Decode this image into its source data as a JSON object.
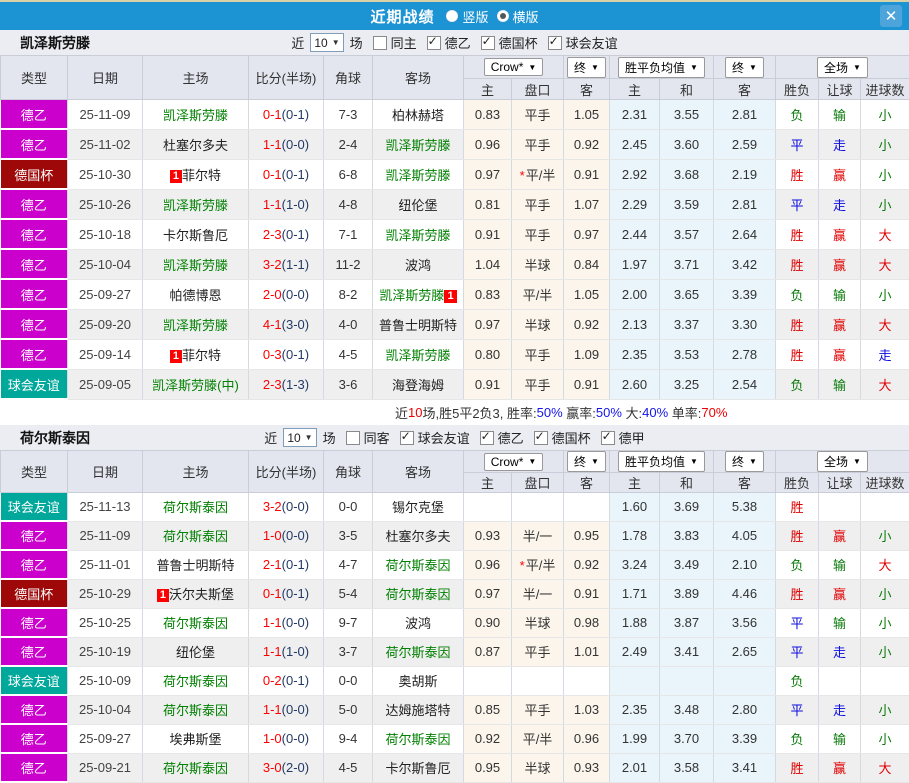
{
  "titlebar": {
    "title": "近期战绩",
    "radios": [
      {
        "label": "竖版",
        "checked": false
      },
      {
        "label": "横版",
        "checked": true
      }
    ],
    "close_icon": "✕",
    "bar_color": "#1C93D2"
  },
  "table": {
    "main_headers": [
      "类型",
      "日期",
      "主场",
      "比分(半场)",
      "角球",
      "客场"
    ],
    "group_headers": [
      {
        "label": "Crow*",
        "span": 2,
        "name": "odds-company-select"
      },
      {
        "label": "终",
        "span": 1,
        "name": "odds-final-select"
      },
      {
        "label": "胜平负均值",
        "span": 2,
        "name": "avg-odds-select"
      },
      {
        "label": "终",
        "span": 1,
        "name": "avg-final-select"
      },
      {
        "label": "全场",
        "span": 3,
        "name": "scope-select"
      }
    ],
    "sub_headers": [
      "主",
      "盘口",
      "客",
      "主",
      "和",
      "客",
      "胜负",
      "让球",
      "进球数"
    ]
  },
  "type_colors": {
    "德乙": "#CC00CC",
    "德国杯": "#9E0808",
    "球会友谊": "#00A79B",
    "德甲": "#CC00CC"
  },
  "result_colors": {
    "胜": "#E00000",
    "赢": "#E00000",
    "大": "#E00000",
    "平": "#0B0BE0",
    "走": "#0B0BE0",
    "负": "#0A7A0A",
    "输": "#0A7A0A",
    "小": "#0A7A0A"
  },
  "sections": [
    {
      "team": "凯泽斯劳滕",
      "filter": {
        "near_label": "近",
        "count": "10",
        "games_label": "场",
        "same": {
          "label": "同主",
          "checked": false
        },
        "leagues": [
          {
            "label": "德乙",
            "checked": true
          },
          {
            "label": "德国杯",
            "checked": true
          },
          {
            "label": "球会友谊",
            "checked": true
          }
        ]
      },
      "rows": [
        {
          "type": "德乙",
          "date": "25-11-09",
          "home": {
            "n": "凯泽斯劳滕",
            "g": true
          },
          "score": "0-1",
          "half": "(0-1)",
          "corner": "7-3",
          "away": {
            "n": "柏林赫塔"
          },
          "odds": [
            "0.83",
            "平手",
            "1.05"
          ],
          "star": false,
          "avg": [
            "2.31",
            "3.55",
            "2.81"
          ],
          "res": [
            "负",
            "输",
            "小"
          ]
        },
        {
          "type": "德乙",
          "date": "25-11-02",
          "home": {
            "n": "杜塞尔多夫"
          },
          "score": "1-1",
          "half": "(0-0)",
          "corner": "2-4",
          "away": {
            "n": "凯泽斯劳滕",
            "g": true
          },
          "odds": [
            "0.96",
            "平手",
            "0.92"
          ],
          "star": false,
          "avg": [
            "2.45",
            "3.60",
            "2.59"
          ],
          "res": [
            "平",
            "走",
            "小"
          ]
        },
        {
          "type": "德国杯",
          "date": "25-10-30",
          "home": {
            "n": "菲尔特",
            "badge": "1",
            "badge_pos": "before"
          },
          "score": "0-1",
          "half": "(0-1)",
          "corner": "6-8",
          "away": {
            "n": "凯泽斯劳滕",
            "g": true
          },
          "odds": [
            "0.97",
            "平/半",
            "0.91"
          ],
          "star": true,
          "avg": [
            "2.92",
            "3.68",
            "2.19"
          ],
          "res": [
            "胜",
            "赢",
            "小"
          ]
        },
        {
          "type": "德乙",
          "date": "25-10-26",
          "home": {
            "n": "凯泽斯劳滕",
            "g": true
          },
          "score": "1-1",
          "half": "(1-0)",
          "corner": "4-8",
          "away": {
            "n": "纽伦堡"
          },
          "odds": [
            "0.81",
            "平手",
            "1.07"
          ],
          "star": false,
          "avg": [
            "2.29",
            "3.59",
            "2.81"
          ],
          "res": [
            "平",
            "走",
            "小"
          ]
        },
        {
          "type": "德乙",
          "date": "25-10-18",
          "home": {
            "n": "卡尔斯鲁厄"
          },
          "score": "2-3",
          "half": "(0-1)",
          "corner": "7-1",
          "away": {
            "n": "凯泽斯劳滕",
            "g": true
          },
          "odds": [
            "0.91",
            "平手",
            "0.97"
          ],
          "star": false,
          "avg": [
            "2.44",
            "3.57",
            "2.64"
          ],
          "res": [
            "胜",
            "赢",
            "大"
          ]
        },
        {
          "type": "德乙",
          "date": "25-10-04",
          "home": {
            "n": "凯泽斯劳滕",
            "g": true
          },
          "score": "3-2",
          "half": "(1-1)",
          "corner": "11-2",
          "away": {
            "n": "波鸿"
          },
          "odds": [
            "1.04",
            "半球",
            "0.84"
          ],
          "star": false,
          "avg": [
            "1.97",
            "3.71",
            "3.42"
          ],
          "res": [
            "胜",
            "赢",
            "大"
          ]
        },
        {
          "type": "德乙",
          "date": "25-09-27",
          "home": {
            "n": "帕德博恩"
          },
          "score": "2-0",
          "half": "(0-0)",
          "corner": "8-2",
          "away": {
            "n": "凯泽斯劳滕",
            "g": true,
            "badge": "1",
            "badge_pos": "after"
          },
          "odds": [
            "0.83",
            "平/半",
            "1.05"
          ],
          "star": false,
          "avg": [
            "2.00",
            "3.65",
            "3.39"
          ],
          "res": [
            "负",
            "输",
            "小"
          ]
        },
        {
          "type": "德乙",
          "date": "25-09-20",
          "home": {
            "n": "凯泽斯劳滕",
            "g": true
          },
          "score": "4-1",
          "half": "(3-0)",
          "corner": "4-0",
          "away": {
            "n": "普鲁士明斯特"
          },
          "odds": [
            "0.97",
            "半球",
            "0.92"
          ],
          "star": false,
          "avg": [
            "2.13",
            "3.37",
            "3.30"
          ],
          "res": [
            "胜",
            "赢",
            "大"
          ]
        },
        {
          "type": "德乙",
          "date": "25-09-14",
          "home": {
            "n": "菲尔特",
            "badge": "1",
            "badge_pos": "before"
          },
          "score": "0-3",
          "half": "(0-1)",
          "corner": "4-5",
          "away": {
            "n": "凯泽斯劳滕",
            "g": true
          },
          "odds": [
            "0.80",
            "平手",
            "1.09"
          ],
          "star": false,
          "avg": [
            "2.35",
            "3.53",
            "2.78"
          ],
          "res": [
            "胜",
            "赢",
            "走"
          ]
        },
        {
          "type": "球会友谊",
          "date": "25-09-05",
          "home": {
            "n": "凯泽斯劳滕(中)",
            "g": true
          },
          "score": "2-3",
          "half": "(1-3)",
          "corner": "3-6",
          "away": {
            "n": "海登海姆"
          },
          "odds": [
            "0.91",
            "平手",
            "0.91"
          ],
          "star": false,
          "avg": [
            "2.60",
            "3.25",
            "2.54"
          ],
          "res": [
            "负",
            "输",
            "大"
          ]
        }
      ],
      "summary": [
        {
          "t": "近",
          "c": "#333"
        },
        {
          "t": "10",
          "c": "#EE0000"
        },
        {
          "t": "场,胜5平2负3, 胜率:",
          "c": "#333"
        },
        {
          "t": "50%",
          "c": "#1414E6"
        },
        {
          "t": " 赢率:",
          "c": "#333"
        },
        {
          "t": "50%",
          "c": "#1414E6"
        },
        {
          "t": " 大:",
          "c": "#333"
        },
        {
          "t": "40%",
          "c": "#1414E6"
        },
        {
          "t": " 单率:",
          "c": "#333"
        },
        {
          "t": "70%",
          "c": "#EE0000"
        }
      ]
    },
    {
      "team": "荷尔斯泰因",
      "filter": {
        "near_label": "近",
        "count": "10",
        "games_label": "场",
        "same": {
          "label": "同客",
          "checked": false
        },
        "leagues": [
          {
            "label": "球会友谊",
            "checked": true
          },
          {
            "label": "德乙",
            "checked": true
          },
          {
            "label": "德国杯",
            "checked": true
          },
          {
            "label": "德甲",
            "checked": true
          }
        ]
      },
      "rows": [
        {
          "type": "球会友谊",
          "date": "25-11-13",
          "home": {
            "n": "荷尔斯泰因",
            "g": true
          },
          "score": "3-2",
          "half": "(0-0)",
          "corner": "0-0",
          "away": {
            "n": "锡尔克堡"
          },
          "odds": [
            "",
            "",
            ""
          ],
          "star": false,
          "avg": [
            "1.60",
            "3.69",
            "5.38"
          ],
          "res": [
            "胜",
            "",
            ""
          ]
        },
        {
          "type": "德乙",
          "date": "25-11-09",
          "home": {
            "n": "荷尔斯泰因",
            "g": true
          },
          "score": "1-0",
          "half": "(0-0)",
          "corner": "3-5",
          "away": {
            "n": "杜塞尔多夫"
          },
          "odds": [
            "0.93",
            "半/一",
            "0.95"
          ],
          "star": false,
          "avg": [
            "1.78",
            "3.83",
            "4.05"
          ],
          "res": [
            "胜",
            "赢",
            "小"
          ]
        },
        {
          "type": "德乙",
          "date": "25-11-01",
          "home": {
            "n": "普鲁士明斯特"
          },
          "score": "2-1",
          "half": "(0-1)",
          "corner": "4-7",
          "away": {
            "n": "荷尔斯泰因",
            "g": true
          },
          "odds": [
            "0.96",
            "平/半",
            "0.92"
          ],
          "star": true,
          "avg": [
            "3.24",
            "3.49",
            "2.10"
          ],
          "res": [
            "负",
            "输",
            "大"
          ]
        },
        {
          "type": "德国杯",
          "date": "25-10-29",
          "home": {
            "n": "沃尔夫斯堡",
            "badge": "1",
            "badge_pos": "before"
          },
          "score": "0-1",
          "half": "(0-1)",
          "corner": "5-4",
          "away": {
            "n": "荷尔斯泰因",
            "g": true
          },
          "odds": [
            "0.97",
            "半/一",
            "0.91"
          ],
          "star": false,
          "avg": [
            "1.71",
            "3.89",
            "4.46"
          ],
          "res": [
            "胜",
            "赢",
            "小"
          ]
        },
        {
          "type": "德乙",
          "date": "25-10-25",
          "home": {
            "n": "荷尔斯泰因",
            "g": true
          },
          "score": "1-1",
          "half": "(0-0)",
          "corner": "9-7",
          "away": {
            "n": "波鸿"
          },
          "odds": [
            "0.90",
            "半球",
            "0.98"
          ],
          "star": false,
          "avg": [
            "1.88",
            "3.87",
            "3.56"
          ],
          "res": [
            "平",
            "输",
            "小"
          ]
        },
        {
          "type": "德乙",
          "date": "25-10-19",
          "home": {
            "n": "纽伦堡"
          },
          "score": "1-1",
          "half": "(1-0)",
          "corner": "3-7",
          "away": {
            "n": "荷尔斯泰因",
            "g": true
          },
          "odds": [
            "0.87",
            "平手",
            "1.01"
          ],
          "star": false,
          "avg": [
            "2.49",
            "3.41",
            "2.65"
          ],
          "res": [
            "平",
            "走",
            "小"
          ]
        },
        {
          "type": "球会友谊",
          "date": "25-10-09",
          "home": {
            "n": "荷尔斯泰因",
            "g": true
          },
          "score": "0-2",
          "half": "(0-1)",
          "corner": "0-0",
          "away": {
            "n": "奥胡斯"
          },
          "odds": [
            "",
            "",
            ""
          ],
          "star": false,
          "avg": [
            "",
            "",
            ""
          ],
          "res": [
            "负",
            "",
            ""
          ]
        },
        {
          "type": "德乙",
          "date": "25-10-04",
          "home": {
            "n": "荷尔斯泰因",
            "g": true
          },
          "score": "1-1",
          "half": "(0-0)",
          "corner": "5-0",
          "away": {
            "n": "达姆施塔特"
          },
          "odds": [
            "0.85",
            "平手",
            "1.03"
          ],
          "star": false,
          "avg": [
            "2.35",
            "3.48",
            "2.80"
          ],
          "res": [
            "平",
            "走",
            "小"
          ]
        },
        {
          "type": "德乙",
          "date": "25-09-27",
          "home": {
            "n": "埃弗斯堡"
          },
          "score": "1-0",
          "half": "(0-0)",
          "corner": "9-4",
          "away": {
            "n": "荷尔斯泰因",
            "g": true
          },
          "odds": [
            "0.92",
            "平/半",
            "0.96"
          ],
          "star": false,
          "avg": [
            "1.99",
            "3.70",
            "3.39"
          ],
          "res": [
            "负",
            "输",
            "小"
          ]
        },
        {
          "type": "德乙",
          "date": "25-09-21",
          "home": {
            "n": "荷尔斯泰因",
            "g": true
          },
          "score": "3-0",
          "half": "(2-0)",
          "corner": "4-5",
          "away": {
            "n": "卡尔斯鲁厄"
          },
          "odds": [
            "0.95",
            "半球",
            "0.93"
          ],
          "star": false,
          "avg": [
            "2.01",
            "3.58",
            "3.41"
          ],
          "res": [
            "胜",
            "赢",
            "大"
          ]
        }
      ],
      "summary": null
    }
  ]
}
